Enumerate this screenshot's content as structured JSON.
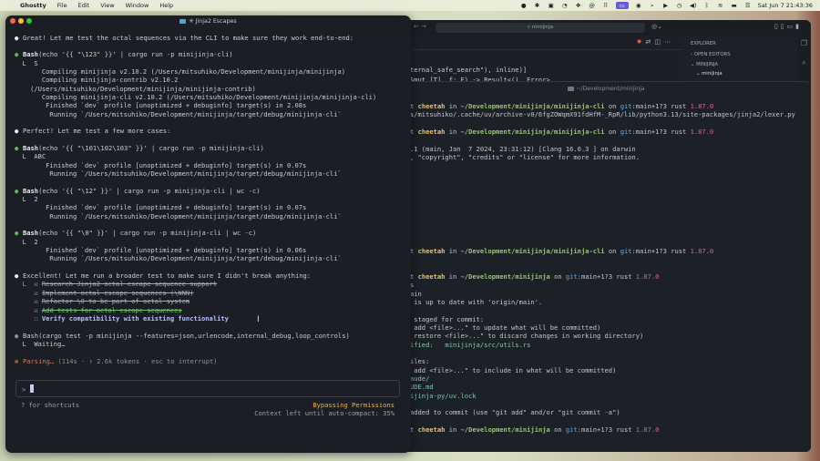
{
  "menubar": {
    "app": "Ghostty",
    "items": [
      "File",
      "Edit",
      "View",
      "Window",
      "Help"
    ],
    "clock": "Sat Jun 7  21:43:36"
  },
  "vscode": {
    "search": "minijinja",
    "explorer": "EXPLORER",
    "open_editors": "OPEN EDITORS",
    "root": "MINIJINJA",
    "folder": "minijinja",
    "code": [
      "ternal_safe_search\"), inline)]",
      "&mut [T], f: F) -> Result<(), Error>"
    ]
  },
  "term2": {
    "title": "~/Development/minijinja",
    "prompt": {
      "user": "t",
      "host": "cheetah",
      "in": " in ",
      "on": " on ",
      "git": "git",
      "branch": ":main+1?3",
      "rust": " rust ",
      "version": "1.87.0"
    },
    "lines": [
      {
        "kind": "prompt",
        "dir": "~/Development/minijinja/minijinja-cli"
      },
      {
        "kind": "text",
        "text": "s/mitsuhiko/.cache/uv/archive-v0/6fgZOWqmX91fdHfM-_RpR/lib/python3.13/site-packages/jinja2/lexer.py"
      },
      {
        "kind": "blank"
      },
      {
        "kind": "prompt",
        "dir": "~/Development/minijinja/minijinja-cli"
      },
      {
        "kind": "blank"
      },
      {
        "kind": "text",
        "text": ".1 (main, Jan  7 2024, 23:31:12) [Clang 16.0.3 ] on darwin"
      },
      {
        "kind": "text",
        "text": ", \"copyright\", \"credits\" or \"license\" for more information."
      },
      {
        "kind": "blank"
      },
      {
        "kind": "blank"
      },
      {
        "kind": "blank"
      },
      {
        "kind": "blank"
      },
      {
        "kind": "blank"
      },
      {
        "kind": "blank"
      },
      {
        "kind": "blank"
      },
      {
        "kind": "blank"
      },
      {
        "kind": "blank"
      },
      {
        "kind": "blank"
      },
      {
        "kind": "prompt",
        "dir": "~/Development/minijinja/minijinja-cli"
      },
      {
        "kind": "blank"
      },
      {
        "kind": "blank"
      },
      {
        "kind": "prompt",
        "dir": "~/Development/minijinja"
      },
      {
        "kind": "text",
        "text": "s"
      },
      {
        "kind": "text",
        "text": "ain"
      },
      {
        "kind": "text",
        "text": " is up to date with 'origin/main'."
      },
      {
        "kind": "blank"
      },
      {
        "kind": "text",
        "text": " staged for commit:"
      },
      {
        "kind": "text",
        "text": " add <file>...\" to update what will be committed)"
      },
      {
        "kind": "text",
        "text": " restore <file>...\" to discard changes in working directory)"
      },
      {
        "kind": "green",
        "text": "ified:   minijinja/src/utils.rs"
      },
      {
        "kind": "blank"
      },
      {
        "kind": "text",
        "text": "iles:"
      },
      {
        "kind": "text",
        "text": " add <file>...\" to include in what will be committed)"
      },
      {
        "kind": "cyan",
        "text": "aude/"
      },
      {
        "kind": "cyan",
        "text": "UDE.md"
      },
      {
        "kind": "cyan",
        "text": "ijinja-py/uv.lock"
      },
      {
        "kind": "blank"
      },
      {
        "kind": "text",
        "text": "added to commit (use \"git add\" and/or \"git commit -a\")"
      },
      {
        "kind": "blank"
      },
      {
        "kind": "prompt",
        "dir": "~/Development/minijinja"
      }
    ]
  },
  "term": {
    "title": "✳ Jinja2 Escapes",
    "lines": [
      {
        "kind": "white",
        "text": "Great! Let me test the octal sequences via the CLI to make sure they work end-to-end:"
      },
      {
        "kind": "blank"
      },
      {
        "kind": "bash",
        "tool": "Bash",
        "text": "(echo '{{ \"\\123\" }}' | cargo run -p minijinja-cli)"
      },
      {
        "kind": "out",
        "text": "  L  S"
      },
      {
        "kind": "out",
        "text": "       Compiling minijinja v2.10.2 (/Users/mitsuhiko/Development/minijinja/minijinja)"
      },
      {
        "kind": "out",
        "text": "       Compiling minijinja-contrib v2.10.2"
      },
      {
        "kind": "out",
        "text": "    (/Users/mitsuhiko/Development/minijinja/minijinja-contrib)"
      },
      {
        "kind": "out",
        "text": "       Compiling minijinja-cli v2.10.2 (/Users/mitsuhiko/Development/minijinja/minijinja-cli)"
      },
      {
        "kind": "out",
        "text": "        Finished `dev` profile [unoptimized + debuginfo] target(s) in 2.08s"
      },
      {
        "kind": "out",
        "text": "         Running `/Users/mitsuhiko/Development/minijinja/target/debug/minijinja-cli`"
      },
      {
        "kind": "blank"
      },
      {
        "kind": "white",
        "text": "Perfect! Let me test a few more cases:"
      },
      {
        "kind": "blank"
      },
      {
        "kind": "bash",
        "tool": "Bash",
        "text": "(echo '{{ \"\\101\\102\\103\" }}' | cargo run -p minijinja-cli)"
      },
      {
        "kind": "out",
        "text": "  L  ABC"
      },
      {
        "kind": "out",
        "text": "        Finished `dev` profile [unoptimized + debuginfo] target(s) in 0.07s"
      },
      {
        "kind": "out",
        "text": "         Running `/Users/mitsuhiko/Development/minijinja/target/debug/minijinja-cli`"
      },
      {
        "kind": "blank"
      },
      {
        "kind": "bash",
        "tool": "Bash",
        "text": "(echo '{{ \"\\12\" }}' | cargo run -p minijinja-cli | wc -c)"
      },
      {
        "kind": "out",
        "text": "  L  2"
      },
      {
        "kind": "out",
        "text": "        Finished `dev` profile [unoptimized + debuginfo] target(s) in 0.07s"
      },
      {
        "kind": "out",
        "text": "         Running `/Users/mitsuhiko/Development/minijinja/target/debug/minijinja-cli`"
      },
      {
        "kind": "blank"
      },
      {
        "kind": "bash",
        "tool": "Bash",
        "text": "(echo '{{ \"\\0\" }}' | cargo run -p minijinja-cli | wc -c)"
      },
      {
        "kind": "out",
        "text": "  L  2"
      },
      {
        "kind": "out",
        "text": "        Finished `dev` profile [unoptimized + debuginfo] target(s) in 0.06s"
      },
      {
        "kind": "out",
        "text": "         Running `/Users/mitsuhiko/Development/minijinja/target/debug/minijinja-cli`"
      },
      {
        "kind": "blank"
      },
      {
        "kind": "white",
        "text": "Excellent! Let me run a broader test to make sure I didn't break anything:"
      },
      {
        "kind": "todo",
        "state": "done",
        "lead": "  L  ☒ ",
        "text": "Research Jinja2 octal escape sequence support"
      },
      {
        "kind": "todo",
        "state": "done",
        "lead": "     ☒ ",
        "text": "Implement octal escape sequences (\\NNN)"
      },
      {
        "kind": "todo",
        "state": "done",
        "lead": "     ☒ ",
        "text": "Refactor \\0 to be part of octal system"
      },
      {
        "kind": "todo",
        "state": "done-green",
        "lead": "     ☒ ",
        "text": "Add tests for octal escape sequences"
      },
      {
        "kind": "todo",
        "state": "pending",
        "lead": "     ☐ ",
        "text": "Verify compatibility with existing functionality"
      },
      {
        "kind": "blank"
      },
      {
        "kind": "grey",
        "text": "Bash(cargo test -p minijinja --features=json,urlencode,internal_debug,loop_controls)"
      },
      {
        "kind": "out",
        "text": "  L  Waiting…"
      },
      {
        "kind": "blank"
      },
      {
        "kind": "parsing",
        "text": "Parsing…",
        "rest": " (114s · ↑ 2.6k tokens · esc to interrupt)"
      }
    ],
    "input_prompt": ">",
    "hint": "? for shortcuts",
    "mode": "Bypassing Permissions",
    "context": "Context left until auto-compact: 35%"
  },
  "colors": {
    "accent_green": "#5cb85c",
    "parsing": "#d9775f",
    "bypass": "#e6b450"
  }
}
